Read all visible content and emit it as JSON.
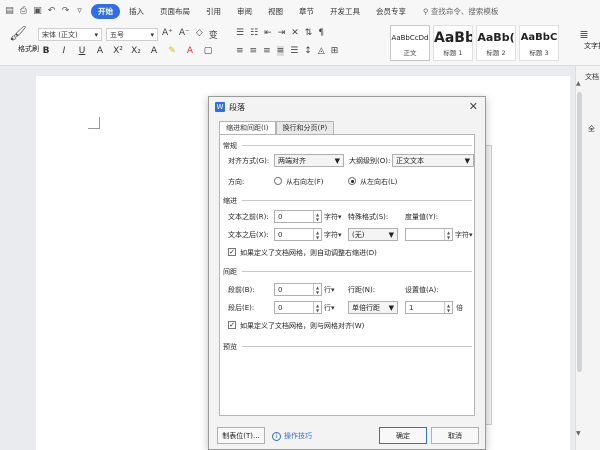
{
  "ribbon": {
    "tabs": [
      "开始",
      "插入",
      "页面布局",
      "引用",
      "审阅",
      "视图",
      "章节",
      "开发工具",
      "会员专享"
    ],
    "active_tab": "开始",
    "search": "查找命令、搜索模板"
  },
  "toolbar": {
    "format_painter": "格式刷",
    "font_name": "宋体 (正文)",
    "font_size": "五号",
    "styles": [
      {
        "preview": "AaBbCcDd",
        "name": "正文"
      },
      {
        "preview": "AaBb",
        "name": "标题 1"
      },
      {
        "preview": "AaBb(",
        "name": "标题 2"
      },
      {
        "preview": "AaBbC",
        "name": "标题 3"
      }
    ],
    "text_layout": "文字排版"
  },
  "side_panel": {
    "top_text": "文档",
    "mid_text": "全"
  },
  "dialog": {
    "title": "段落",
    "tabs": [
      "缩进和间距(I)",
      "换行和分页(P)"
    ],
    "general": {
      "section": "常规",
      "alignment_label": "对齐方式(G):",
      "alignment_value": "两端对齐",
      "outline_label": "大纲级别(O):",
      "outline_value": "正文文本",
      "direction_label": "方向:",
      "rtl_label": "从右向左(F)",
      "ltr_label": "从左向右(L)"
    },
    "indent": {
      "section": "缩进",
      "before_label": "文本之前(R):",
      "before_value": "0",
      "after_label": "文本之后(X):",
      "after_value": "0",
      "unit": "字符▾",
      "special_label": "特殊格式(S):",
      "special_value": "(无)",
      "measure_label": "度量值(Y):",
      "measure_value": "",
      "measure_unit": "字符▾",
      "grid_check": "如果定义了文档网格，则自动调整右缩进(D)"
    },
    "spacing": {
      "section": "间距",
      "before_label": "段前(B):",
      "before_value": "0",
      "after_label": "段后(E):",
      "after_value": "0",
      "unit": "行▾",
      "line_label": "行距(N):",
      "line_value": "单倍行距",
      "setting_label": "设置值(A):",
      "setting_value": "1",
      "setting_unit": "倍",
      "grid_check": "如果定义了文档网格，则与网格对齐(W)"
    },
    "preview": {
      "section": "预览"
    },
    "buttons": {
      "tabs": "制表位(T)...",
      "tips": "操作技巧",
      "ok": "确定",
      "cancel": "取消"
    }
  }
}
